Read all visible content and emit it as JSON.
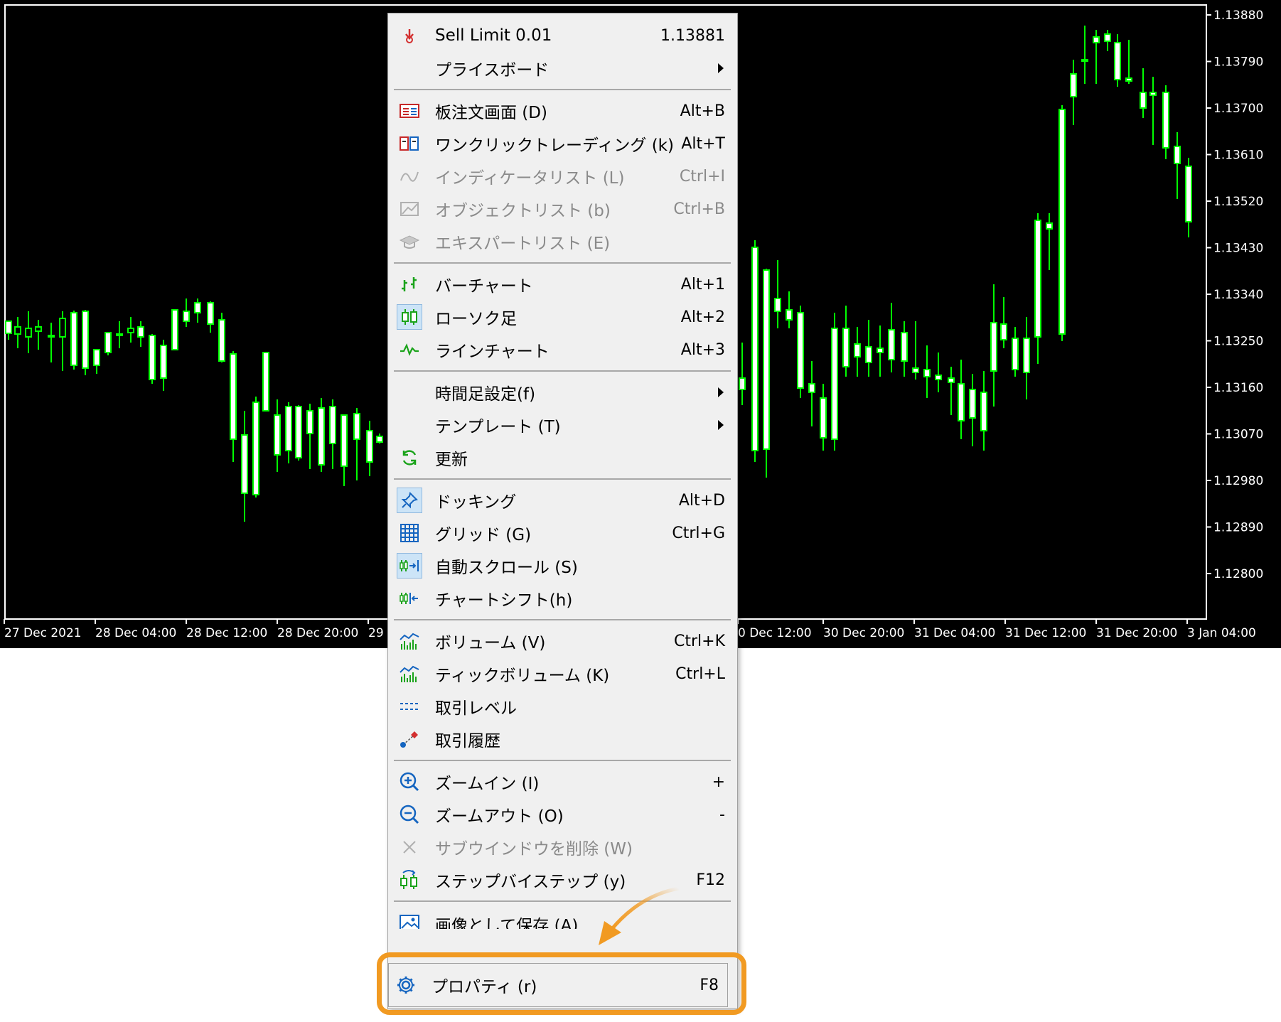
{
  "chart": {
    "background": "#000000",
    "candle_color": "#00ff00",
    "bull_fill": "#000000",
    "bear_fill": "#ffffff",
    "price_scale": [
      "1.13880",
      "1.13790",
      "1.13700",
      "1.13610",
      "1.13520",
      "1.13430",
      "1.13340",
      "1.13250",
      "1.13160",
      "1.13070",
      "1.12980",
      "1.12890",
      "1.12800"
    ],
    "time_scale": [
      "27 Dec 2021",
      "28 Dec 04:00",
      "28 Dec 12:00",
      "28 Dec 20:00",
      "29",
      "0 Dec 12:00",
      "30 Dec 20:00",
      "31 Dec 04:00",
      "31 Dec 12:00",
      "31 Dec 20:00",
      "3 Jan 04:00"
    ]
  },
  "menu": {
    "items": [
      {
        "label": "Sell Limit 0.01",
        "shortcut": "1.13881",
        "icon": "sell-limit-icon",
        "enabled": true
      },
      {
        "label": "プライスボード",
        "shortcut": "",
        "icon": "",
        "submenu": true,
        "enabled": true
      },
      {
        "label": "板注文画面 (D)",
        "shortcut": "Alt+B",
        "icon": "depth-of-market-icon",
        "enabled": true
      },
      {
        "label": "ワンクリックトレーディング (k)",
        "shortcut": "Alt+T",
        "icon": "one-click-trading-icon",
        "enabled": true
      },
      {
        "label": "インディケータリスト (L)",
        "shortcut": "Ctrl+I",
        "icon": "indicator-list-icon",
        "enabled": false
      },
      {
        "label": "オブジェクトリスト (b)",
        "shortcut": "Ctrl+B",
        "icon": "object-list-icon",
        "enabled": false
      },
      {
        "label": "エキスパートリスト (E)",
        "shortcut": "",
        "icon": "expert-list-icon",
        "enabled": false
      },
      {
        "label": "バーチャート",
        "shortcut": "Alt+1",
        "icon": "bar-chart-icon",
        "enabled": true
      },
      {
        "label": "ローソク足",
        "shortcut": "Alt+2",
        "icon": "candlestick-icon",
        "checked": true,
        "enabled": true
      },
      {
        "label": "ラインチャート",
        "shortcut": "Alt+3",
        "icon": "line-chart-icon",
        "enabled": true
      },
      {
        "label": "時間足設定(f)",
        "shortcut": "",
        "icon": "",
        "submenu": true,
        "enabled": true
      },
      {
        "label": "テンプレート (T)",
        "shortcut": "",
        "icon": "",
        "submenu": true,
        "enabled": true
      },
      {
        "label": "更新",
        "shortcut": "",
        "icon": "refresh-icon",
        "enabled": true
      },
      {
        "label": "ドッキング",
        "shortcut": "Alt+D",
        "icon": "pin-icon",
        "checked": true,
        "enabled": true
      },
      {
        "label": "グリッド (G)",
        "shortcut": "Ctrl+G",
        "icon": "grid-icon",
        "enabled": true
      },
      {
        "label": "自動スクロール (S)",
        "shortcut": "",
        "icon": "auto-scroll-icon",
        "checked": true,
        "enabled": true
      },
      {
        "label": "チャートシフト(h)",
        "shortcut": "",
        "icon": "chart-shift-icon",
        "enabled": true
      },
      {
        "label": "ボリューム (V)",
        "shortcut": "Ctrl+K",
        "icon": "volume-icon",
        "enabled": true
      },
      {
        "label": "ティックボリューム (K)",
        "shortcut": "Ctrl+L",
        "icon": "tick-volume-icon",
        "enabled": true
      },
      {
        "label": "取引レベル",
        "shortcut": "",
        "icon": "trade-levels-icon",
        "enabled": true
      },
      {
        "label": "取引履歴",
        "shortcut": "",
        "icon": "trade-history-icon",
        "enabled": true
      },
      {
        "label": "ズームイン (I)",
        "shortcut": "+",
        "icon": "zoom-in-icon",
        "enabled": true
      },
      {
        "label": "ズームアウト (O)",
        "shortcut": "-",
        "icon": "zoom-out-icon",
        "enabled": true
      },
      {
        "label": "サブウインドウを削除 (W)",
        "shortcut": "",
        "icon": "delete-subwindow-icon",
        "enabled": false
      },
      {
        "label": "ステップバイステップ (y)",
        "shortcut": "F12",
        "icon": "step-by-step-icon",
        "enabled": true
      },
      {
        "label": "画像として保存 (A)",
        "shortcut": "",
        "icon": "save-image-icon",
        "enabled": true
      },
      {
        "label": "プロパティ (r)",
        "shortcut": "F8",
        "icon": "gear-icon",
        "enabled": true,
        "highlighted": true
      }
    ]
  },
  "annotation": {
    "highlight_color": "#f19a22"
  }
}
